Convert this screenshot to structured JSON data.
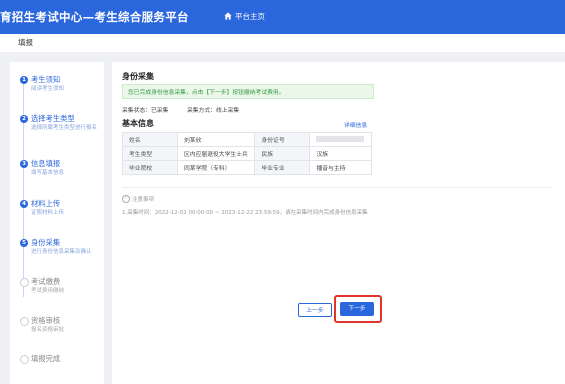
{
  "header": {
    "title": "育招生考试中心—考生综合服务平台",
    "home_link": "平台主页"
  },
  "breadcrumb": "填报",
  "steps": [
    {
      "num": "1",
      "name": "考生须知",
      "desc": "阅读考生须知",
      "state": "done"
    },
    {
      "num": "2",
      "name": "选择考生类型",
      "desc": "选择所属考生类型进行报名",
      "state": "done"
    },
    {
      "num": "3",
      "name": "信息填报",
      "desc": "填写基本信息",
      "state": "done"
    },
    {
      "num": "4",
      "name": "材料上传",
      "desc": "证照材料上传",
      "state": "done"
    },
    {
      "num": "5",
      "name": "身份采集",
      "desc": "进行身份信息采集及确认",
      "state": "current"
    },
    {
      "num": "",
      "name": "考试缴费",
      "desc": "考试费用缴纳",
      "state": "todo"
    },
    {
      "num": "",
      "name": "资格审核",
      "desc": "报名资格审批",
      "state": "todo"
    },
    {
      "num": "",
      "name": "填报完成",
      "desc": "",
      "state": "todo"
    }
  ],
  "main": {
    "section_title": "身份采集",
    "notice": "您已完成身份信息采集，点击【下一步】按钮缴纳考试费用。",
    "collect_status": "采集状态：已采集",
    "collect_method": "采集方式：线上采集",
    "basic_title": "基本信息",
    "detail_link": "详细信息",
    "table": [
      [
        "姓名",
        "刘某欣",
        "身份证号",
        ""
      ],
      [
        "考生类型",
        "区内应届退役大学生士兵",
        "民族",
        "汉族"
      ],
      [
        "毕业院校",
        "同某学院（专科）",
        "毕业专业",
        "播音与主持"
      ]
    ],
    "note_title": "注意事项",
    "note_text": "1.采集时间：2022-12-02 00:00:00 ~ 2023-12-22 23:59:59，请在采集时间内完成身份信息采集",
    "prev_label": "上一步",
    "next_label": "下一步"
  },
  "colors": {
    "primary": "#2a66dc",
    "highlight": "#e0352a",
    "notice_text": "#3a9b48"
  }
}
